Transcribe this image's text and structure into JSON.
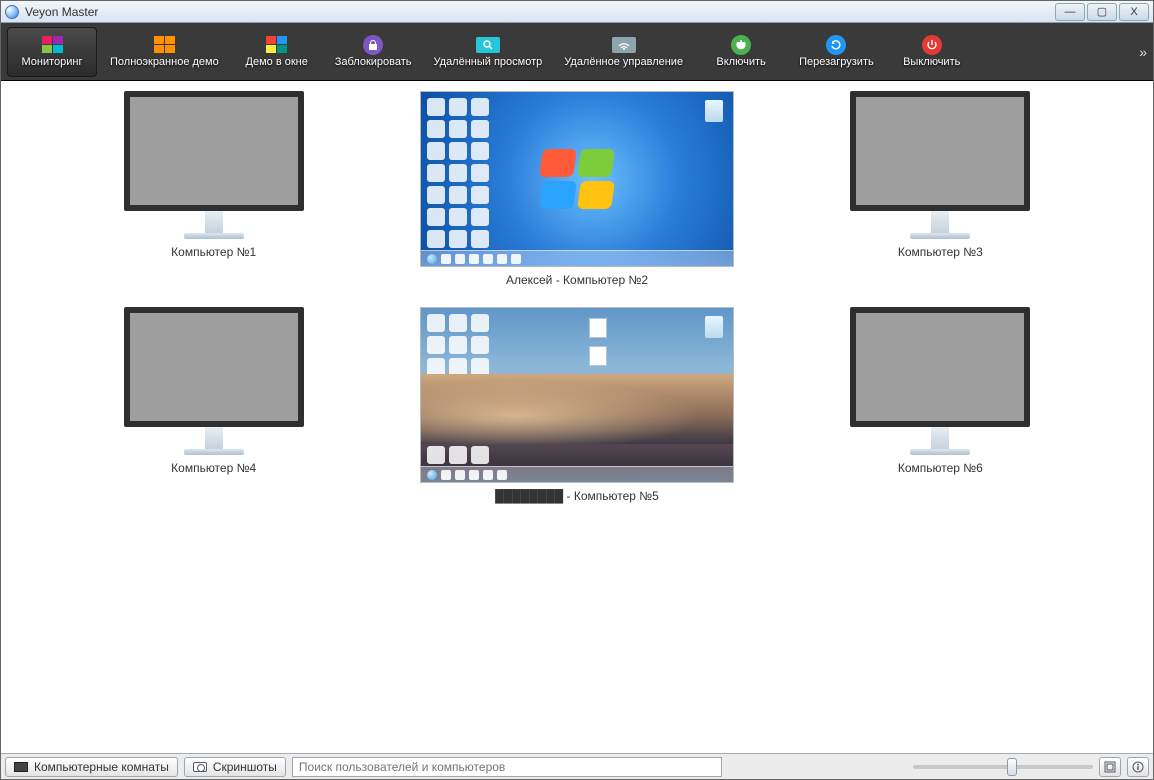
{
  "window": {
    "title": "Veyon Master"
  },
  "toolbar": {
    "items": [
      {
        "key": "monitoring",
        "label": "Мониторинг"
      },
      {
        "key": "fullscreen",
        "label": "Полноэкранное демо"
      },
      {
        "key": "windowed",
        "label": "Демо в окне"
      },
      {
        "key": "lock",
        "label": "Заблокировать"
      },
      {
        "key": "remote_view",
        "label": "Удалённый просмотр"
      },
      {
        "key": "remote_ctrl",
        "label": "Удалённое управление"
      },
      {
        "key": "power_on",
        "label": "Включить"
      },
      {
        "key": "reboot",
        "label": "Перезагрузить"
      },
      {
        "key": "power_off",
        "label": "Выключить"
      }
    ]
  },
  "computers": [
    {
      "label": "Компьютер №1",
      "online": false
    },
    {
      "label": "Алексей - Компьютер №2",
      "online": true,
      "style": "win7"
    },
    {
      "label": "Компьютер №3",
      "online": false
    },
    {
      "label": "Компьютер №4",
      "online": false
    },
    {
      "label": "████████ - Компьютер №5",
      "online": true,
      "style": "beach"
    },
    {
      "label": "Компьютер №6",
      "online": false
    }
  ],
  "bottombar": {
    "rooms_label": "Компьютерные комнаты",
    "screenshots_label": "Скриншоты",
    "search_placeholder": "Поиск пользователей и компьютеров",
    "zoom_percent": 55
  }
}
